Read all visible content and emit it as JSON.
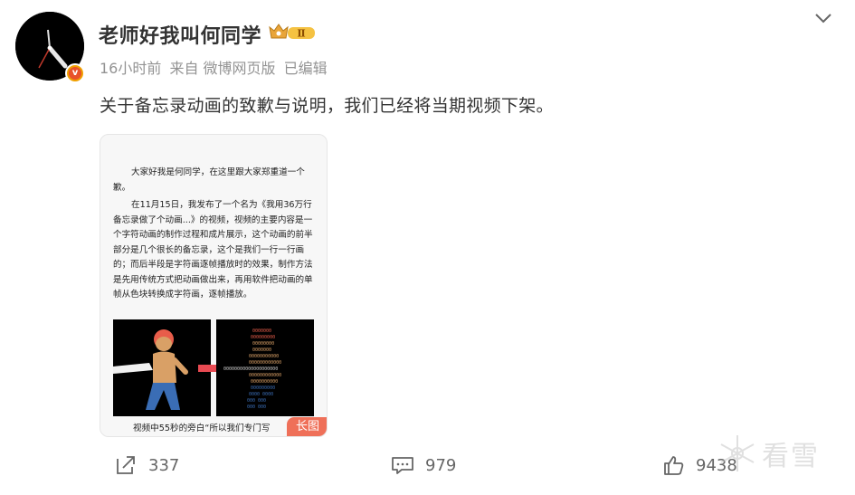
{
  "post": {
    "username": "老师好我叫何同学",
    "vip_level": "Ⅱ",
    "meta": {
      "time": "16小时前",
      "source": "来自 微博网页版",
      "edited": "已编辑"
    },
    "text": "关于备忘录动画的致歉与说明，我们已经将当期视频下架。",
    "image": {
      "paragraph1": "大家好我是何同学，在这里跟大家郑重道一个歉。",
      "paragraph2": "在11月15日，我发布了一个名为《我用36万行备忘录做了个动画...》的视频，视频的主要内容是一个字符动画的制作过程和成片展示，这个动画的前半部分是几个很长的备忘录，这个是我们一行一行画的；而后半段是字符画逐帧播放时的效果，制作方法是先用传统方式把动画做出来，再用软件把动画的单帧从色块转换成字符画，逐帧播放。",
      "caption": "视频中55秒的旁白“所以我们专门写",
      "long_badge": "长图"
    }
  },
  "actions": {
    "share_count": "337",
    "comment_count": "979",
    "like_count": "9438"
  },
  "watermark": {
    "text": "看雪"
  },
  "icons": {
    "expand": "chevron-down-icon",
    "share": "share-icon",
    "comment": "comment-icon",
    "like": "thumbs-up-icon",
    "verified": "verified-badge-icon"
  },
  "colors": {
    "meta_gray": "#939393",
    "verified_orange": "#f0a000",
    "long_badge": "#ef7059"
  }
}
